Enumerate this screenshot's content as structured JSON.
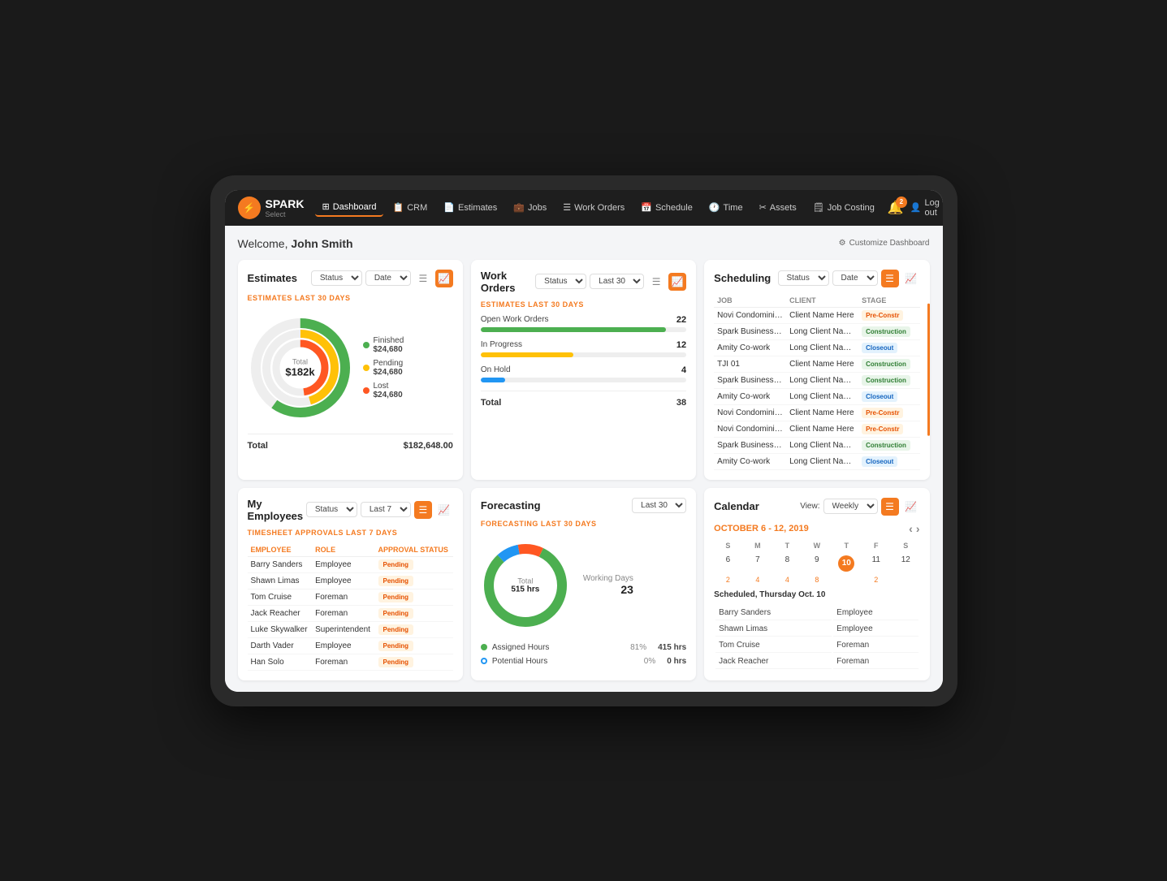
{
  "app": {
    "logo_symbol": "⚡",
    "logo_name": "SPARK",
    "logo_sub": "Select"
  },
  "nav": {
    "items": [
      {
        "label": "Dashboard",
        "icon": "⊞",
        "active": true
      },
      {
        "label": "CRM",
        "icon": "📋",
        "active": false
      },
      {
        "label": "Estimates",
        "icon": "📄",
        "active": false
      },
      {
        "label": "Jobs",
        "icon": "💼",
        "active": false
      },
      {
        "label": "Work Orders",
        "icon": "☰",
        "active": false
      },
      {
        "label": "Schedule",
        "icon": "📅",
        "active": false
      },
      {
        "label": "Time",
        "icon": "🕐",
        "active": false
      },
      {
        "label": "Assets",
        "icon": "✂",
        "active": false
      },
      {
        "label": "Job Costing",
        "icon": "🗒",
        "active": false
      }
    ],
    "notifications": {
      "count": "2"
    },
    "logout_label": "Log out"
  },
  "welcome": {
    "greeting": "Welcome, ",
    "username": "John Smith",
    "customize": "Customize Dashboard"
  },
  "estimates": {
    "title": "Estimates",
    "section_label": "ESTIMATES LAST 30 DAYS",
    "status_label": "Status",
    "date_label": "Date",
    "donut": {
      "center_label": "Total",
      "center_value": "$182k"
    },
    "legend": [
      {
        "label": "Finished",
        "value": "$24,680",
        "color": "#4caf50"
      },
      {
        "label": "Pending",
        "value": "$24,680",
        "color": "#ffc107"
      },
      {
        "label": "Lost",
        "value": "$24,680",
        "color": "#ff5722"
      }
    ],
    "footer_label": "Total",
    "footer_value": "$182,648.00"
  },
  "work_orders": {
    "title": "Work Orders",
    "section_label": "ESTIMATES LAST 30 DAYS",
    "status_label": "Status",
    "last30_label": "Last 30",
    "items": [
      {
        "label": "Open Work Orders",
        "count": 22,
        "percent": 90,
        "color": "#4caf50"
      },
      {
        "label": "In Progress",
        "count": 12,
        "percent": 45,
        "color": "#ffc107"
      },
      {
        "label": "On Hold",
        "count": 4,
        "percent": 10,
        "color": "#2196f3"
      }
    ],
    "footer_label": "Total",
    "footer_value": "38"
  },
  "scheduling": {
    "title": "Scheduling",
    "status_label": "Status",
    "date_label": "Date",
    "columns": [
      "JOB",
      "CLIENT",
      "STAGE"
    ],
    "rows": [
      {
        "job": "Novi Condominiums",
        "client": "Client Name Here",
        "stage": "Pre-Constr",
        "badge": "preconstruction"
      },
      {
        "job": "Spark Business Wor...",
        "client": "Long Client Nam...",
        "stage": "Construction",
        "badge": "construction"
      },
      {
        "job": "Amity Co-work",
        "client": "Long Client Nam...",
        "stage": "Closeout",
        "badge": "closeout"
      },
      {
        "job": "TJI 01",
        "client": "Client Name Here",
        "stage": "Construction",
        "badge": "construction"
      },
      {
        "job": "Spark Business Wor...",
        "client": "Long Client Nam...",
        "stage": "Construction",
        "badge": "construction"
      },
      {
        "job": "Amity Co-work",
        "client": "Long Client Nam...",
        "stage": "Closeout",
        "badge": "closeout"
      },
      {
        "job": "Novi Condominiums",
        "client": "Client Name Here",
        "stage": "Pre-Constr",
        "badge": "preconstruction"
      },
      {
        "job": "Novi Condominiums",
        "client": "Client Name Here",
        "stage": "Pre-Constr",
        "badge": "preconstruction"
      },
      {
        "job": "Spark Business Wor...",
        "client": "Long Client Nam...",
        "stage": "Construction",
        "badge": "construction"
      },
      {
        "job": "Amity Co-work",
        "client": "Long Client Nam...",
        "stage": "Closeout",
        "badge": "closeout"
      }
    ]
  },
  "employees": {
    "title": "My Employees",
    "section_label": "TIMESHEET APPROVALS LAST 7 DAYS",
    "status_label": "Status",
    "last7_label": "Last 7",
    "columns": [
      "EMPLOYEE",
      "ROLE",
      "APPROVAL STATUS"
    ],
    "rows": [
      {
        "name": "Barry Sanders",
        "role": "Employee",
        "status": "Pending"
      },
      {
        "name": "Shawn Limas",
        "role": "Employee",
        "status": "Pending"
      },
      {
        "name": "Tom Cruise",
        "role": "Foreman",
        "status": "Pending"
      },
      {
        "name": "Jack Reacher",
        "role": "Foreman",
        "status": "Pending"
      },
      {
        "name": "Luke Skywalker",
        "role": "Superintendent",
        "status": "Pending"
      },
      {
        "name": "Darth Vader",
        "role": "Employee",
        "status": "Pending"
      },
      {
        "name": "Han Solo",
        "role": "Foreman",
        "status": "Pending"
      }
    ]
  },
  "forecasting": {
    "title": "Forecasting",
    "section_label": "FORECASTING LAST 30 DAYS",
    "last30_label": "Last 30",
    "donut": {
      "center_label": "Total",
      "center_value": "515 hrs"
    },
    "working_days_label": "Working Days",
    "working_days_value": "23",
    "items": [
      {
        "label": "Assigned Hours",
        "percent": "81%",
        "value": "415 hrs",
        "color": "#4caf50"
      },
      {
        "label": "Potential Hours",
        "percent": "0%",
        "value": "0 hrs",
        "color": "#2196f3"
      }
    ]
  },
  "calendar": {
    "title": "Calendar",
    "view_label": "View:",
    "view_option": "Weekly",
    "month_label": "OCTOBER 6 - 12, 2019",
    "day_headers": [
      "S",
      "M",
      "T",
      "W",
      "T",
      "F",
      "S"
    ],
    "days": [
      {
        "num": "6",
        "today": false,
        "near": false
      },
      {
        "num": "7",
        "today": false,
        "near": false
      },
      {
        "num": "8",
        "today": false,
        "near": false
      },
      {
        "num": "9",
        "today": false,
        "near": false
      },
      {
        "num": "10",
        "today": true,
        "near": false
      },
      {
        "num": "11",
        "today": false,
        "near": false
      },
      {
        "num": "12",
        "today": false,
        "near": false
      }
    ],
    "sub_counts": [
      "2",
      "4",
      "4",
      "8",
      "",
      "2",
      ""
    ],
    "scheduled_label": "Scheduled, Thursday Oct. 10",
    "scheduled_rows": [
      {
        "name": "Barry Sanders",
        "role": "Employee"
      },
      {
        "name": "Shawn Limas",
        "role": "Employee"
      },
      {
        "name": "Tom Cruise",
        "role": "Foreman"
      },
      {
        "name": "Jack Reacher",
        "role": "Foreman"
      }
    ]
  }
}
